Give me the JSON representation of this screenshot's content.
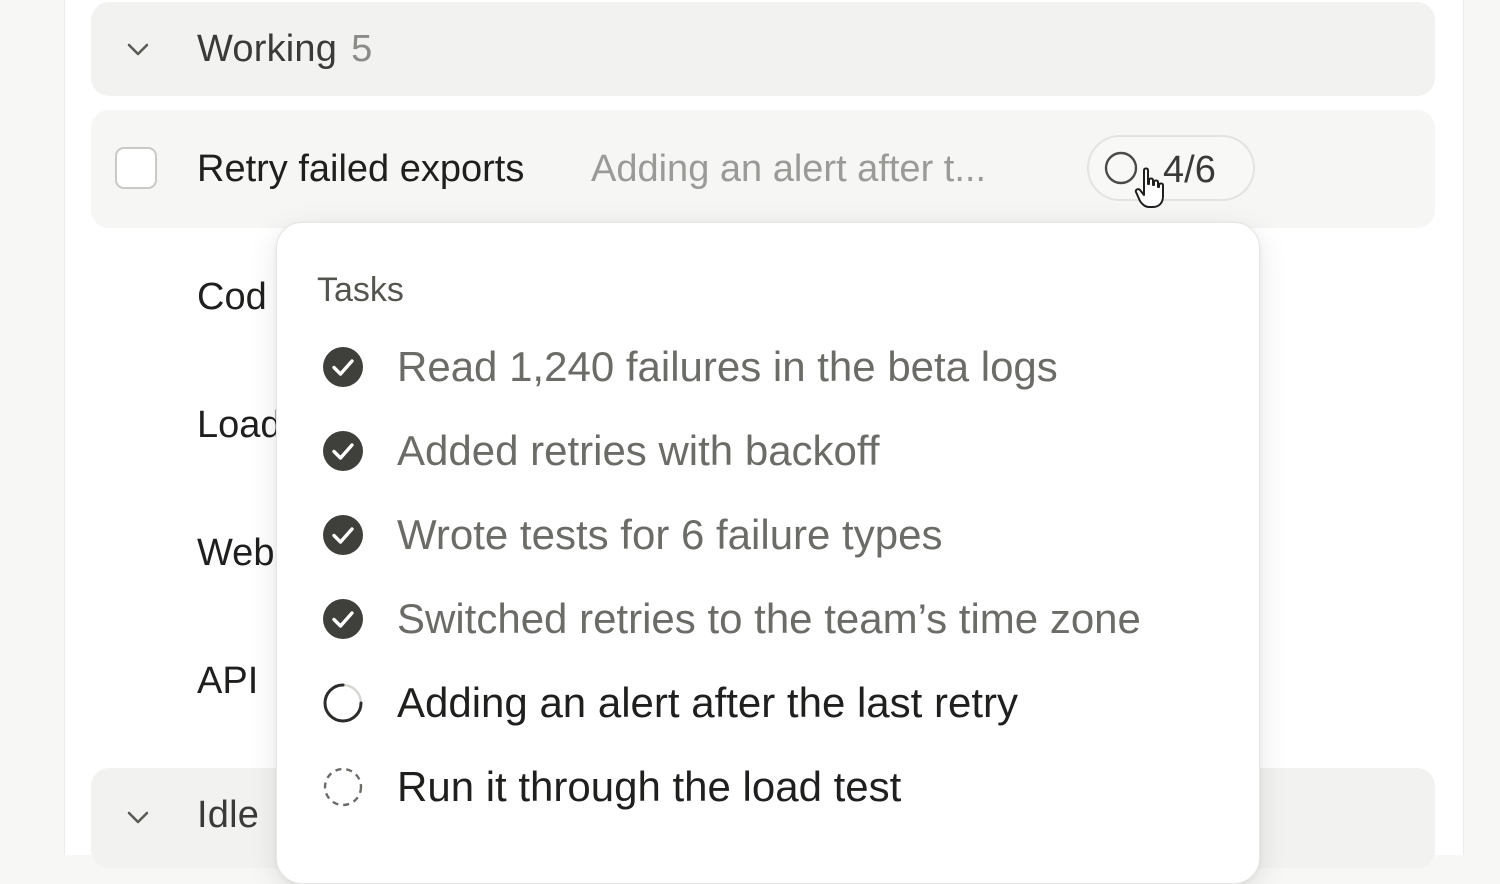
{
  "groups": {
    "working": {
      "title": "Working",
      "count": "5"
    },
    "idle": {
      "title": "Idle"
    }
  },
  "task_row": {
    "title": "Retry failed exports",
    "subtitle": "Adding an alert after t...",
    "progress": "4/6"
  },
  "background_rows": [
    "Cod",
    "Load",
    "Web",
    "API"
  ],
  "popover": {
    "title": "Tasks",
    "items": [
      {
        "label": "Read 1,240 failures in the beta logs",
        "status": "done"
      },
      {
        "label": "Added retries with backoff",
        "status": "done"
      },
      {
        "label": "Wrote tests for 6 failure types",
        "status": "done"
      },
      {
        "label": "Switched retries to the team’s time zone",
        "status": "done"
      },
      {
        "label": "Adding an alert after the last retry",
        "status": "in-progress"
      },
      {
        "label": "Run it through the load test",
        "status": "pending"
      }
    ]
  },
  "colors": {
    "done_icon": "#3f3f3c",
    "done_text": "#6b6b67",
    "active_text": "#1f1f1e",
    "muted_text": "#9a9a97"
  }
}
